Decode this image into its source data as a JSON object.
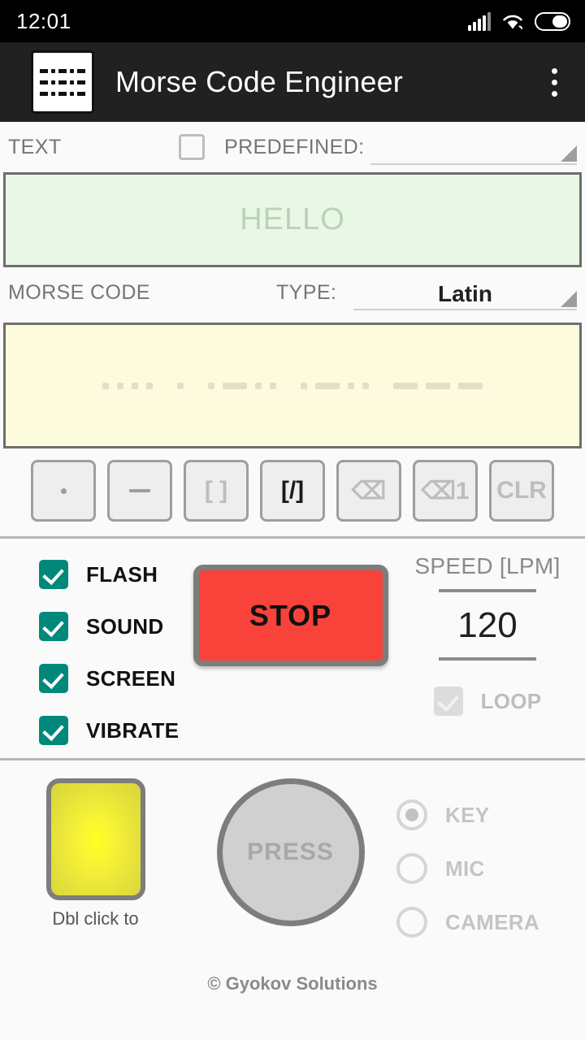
{
  "status_bar": {
    "time": "12:01",
    "icons": [
      "signal-icon",
      "wifi-icon",
      "battery-icon"
    ]
  },
  "app_bar": {
    "icon": "morse-grid-icon",
    "title": "Morse Code Engineer",
    "overflow_menu": "overflow-menu-icon"
  },
  "text_section": {
    "label": "TEXT",
    "predefined_label": "PREDEFINED:",
    "predefined_checked": false,
    "predefined_value": "",
    "input_placeholder": "HELLO",
    "input_value": ""
  },
  "morse_section": {
    "label": "MORSE CODE",
    "type_label": "TYPE:",
    "type_value": "Latin",
    "code_text": ".... . .-.. .-.. ---",
    "letters": [
      {
        "char": "H",
        "symbols": [
          "dot",
          "dot",
          "dot",
          "dot"
        ]
      },
      {
        "char": "E",
        "symbols": [
          "dot"
        ]
      },
      {
        "char": "L",
        "symbols": [
          "dot",
          "dash",
          "dot",
          "dot"
        ]
      },
      {
        "char": "L",
        "symbols": [
          "dot",
          "dash",
          "dot",
          "dot"
        ]
      },
      {
        "char": "O",
        "symbols": [
          "dash",
          "dash",
          "dash"
        ]
      }
    ]
  },
  "keypad": {
    "buttons": [
      {
        "name": "dot-button",
        "label": "",
        "glyph": "dot",
        "enabled": true
      },
      {
        "name": "dash-button",
        "label": "",
        "glyph": "dash",
        "enabled": true
      },
      {
        "name": "letter-gap-button",
        "label": "[ ]",
        "glyph": "text",
        "enabled": false
      },
      {
        "name": "word-gap-button",
        "label": "[/]",
        "glyph": "text",
        "enabled": true
      },
      {
        "name": "backspace-button",
        "label": "⌫",
        "glyph": "text",
        "enabled": false
      },
      {
        "name": "backspace-one-button",
        "label": "⌫1",
        "glyph": "text",
        "enabled": false
      },
      {
        "name": "clear-button",
        "label": "CLR",
        "glyph": "text",
        "enabled": false
      }
    ]
  },
  "output_options": {
    "items": [
      {
        "label": "FLASH",
        "checked": true
      },
      {
        "label": "SOUND",
        "checked": true
      },
      {
        "label": "SCREEN",
        "checked": true
      },
      {
        "label": "VIBRATE",
        "checked": true
      }
    ]
  },
  "transmit": {
    "button_label": "STOP",
    "button_color": "#f9423a",
    "running": true
  },
  "speed": {
    "title": "SPEED [LPM]",
    "value": "120",
    "loop_label": "LOOP",
    "loop_checked": true,
    "loop_enabled": false
  },
  "manual": {
    "lamp_name": "flash-lamp",
    "lamp_caption": "Dbl click to",
    "press_label": "PRESS",
    "sources": [
      {
        "label": "KEY",
        "selected": true
      },
      {
        "label": "MIC",
        "selected": false
      },
      {
        "label": "CAMERA",
        "selected": false
      }
    ]
  },
  "footer": {
    "copyright": "© Gyokov Solutions"
  },
  "colors": {
    "accent_teal": "#00897b",
    "stop_red": "#f9423a",
    "text_field_bg": "#e9f8e6",
    "morse_field_bg": "#fdfbdd",
    "lamp_yellow": "#ffff22",
    "appbar_bg": "#212121"
  }
}
